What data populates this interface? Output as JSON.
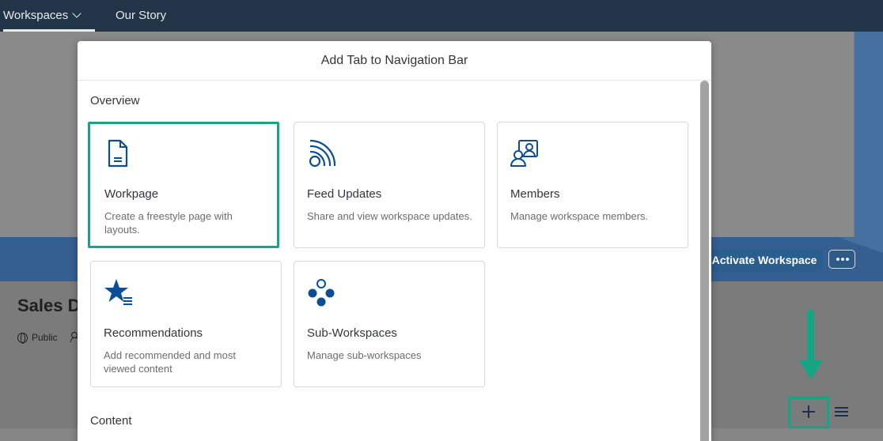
{
  "topbar": {
    "workspaces_label": "Workspaces",
    "story_label": "Our Story"
  },
  "background": {
    "workspace_title": "Sales D",
    "visibility": "Public",
    "activate_button": "Activate Workspace"
  },
  "dialog": {
    "title": "Add Tab to Navigation Bar",
    "sections": {
      "overview": "Overview",
      "content": "Content"
    },
    "tiles": [
      {
        "title": "Workpage",
        "description": "Create a freestyle page with layouts.",
        "icon": "document-icon",
        "selected": true
      },
      {
        "title": "Feed Updates",
        "description": "Share and view workspace updates.",
        "icon": "feed-icon",
        "selected": false
      },
      {
        "title": "Members",
        "description": "Manage workspace members.",
        "icon": "members-icon",
        "selected": false
      },
      {
        "title": "Recommendations",
        "description": "Add recommended and most viewed content",
        "icon": "star-list-icon",
        "selected": false
      },
      {
        "title": "Sub-Workspaces",
        "description": "Manage sub-workspaces",
        "icon": "sub-workspaces-icon",
        "selected": false
      }
    ]
  },
  "colors": {
    "topbar": "#223548",
    "highlight": "#16a584",
    "icon": "#0a4e94",
    "activate_button": "#2a5e8f"
  }
}
